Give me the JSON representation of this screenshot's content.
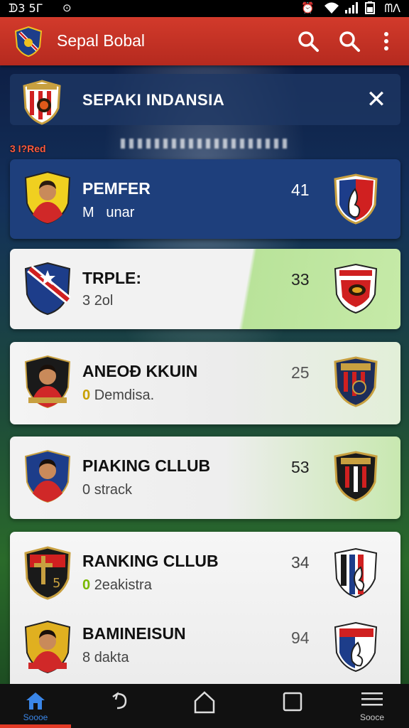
{
  "status_bar": {
    "time": "ᗫ3 5Γ",
    "right_text": "ᗰΛ"
  },
  "app_bar": {
    "title": "Sepal Bobal"
  },
  "banner": {
    "title": "SEPAKI INDANSIA",
    "close": "✕"
  },
  "section_label": "3 I?Red",
  "cards": [
    {
      "name": "PEMFER",
      "prefix": "M",
      "sub": "  unar",
      "score": "41"
    },
    {
      "name": "TRPLE:",
      "prefix": "3",
      "sub": "2ol",
      "score": "33"
    },
    {
      "name": "ANEOÐ KKUIN",
      "prefix": "0",
      "sub": "Demdisa.",
      "score": "25"
    },
    {
      "name": "PIAKING CLLUB",
      "prefix": "0",
      "sub": "strack",
      "score": "53"
    },
    {
      "name": "RANKING CLLUB",
      "prefix": "0",
      "sub": "2eakistra",
      "score": "34"
    },
    {
      "name": "BAMINEISUN",
      "prefix": "8",
      "sub": "dakta",
      "score": "94"
    }
  ],
  "nav": {
    "home_label": "Soooe",
    "menu_label": "Sooce"
  },
  "colors": {
    "accent": "#d23a2b",
    "card_dark": "#1e3f7c",
    "nav_active": "#3a86e8"
  }
}
